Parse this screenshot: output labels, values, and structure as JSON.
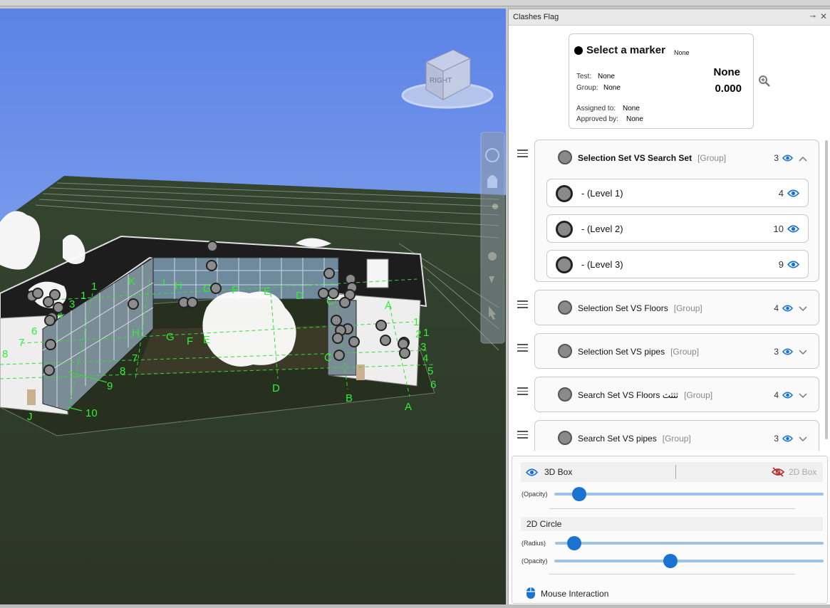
{
  "panel": {
    "title": "Clashes Flag",
    "pin_glyph": "⊸",
    "close_glyph": "✕"
  },
  "marker": {
    "title": "Select a marker",
    "title_value": "None",
    "test_label": "Test:",
    "test_value": "None",
    "group_label": "Group:",
    "group_value": "None",
    "assigned_label": "Assigned to:",
    "assigned_value": "None",
    "approved_label": "Approved by:",
    "approved_value": "None",
    "status": "None",
    "distance": "0.000",
    "zoom_icon": "magnifier-plus-icon"
  },
  "groups": [
    {
      "name": "Selection Set VS Search Set",
      "tag": "[Group]",
      "count": "3",
      "expanded": true,
      "children": [
        {
          "name": "- (Level 1)",
          "count": "4"
        },
        {
          "name": "- (Level 2)",
          "count": "10"
        },
        {
          "name": "- (Level 3)",
          "count": "9"
        }
      ]
    },
    {
      "name": "Selection Set VS Floors",
      "tag": "[Group]",
      "count": "4",
      "expanded": false
    },
    {
      "name": "Selection Set VS pipes",
      "tag": "[Group]",
      "count": "3",
      "expanded": false
    },
    {
      "name": "Search Set VS Floors ثثثث",
      "tag": "[Group]",
      "count": "4",
      "expanded": false
    },
    {
      "name": "Search Set VS pipes",
      "tag": "[Group]",
      "count": "3",
      "expanded": false
    }
  ],
  "settings": {
    "box3d_label": "3D Box",
    "box2d_label": "2D Box",
    "box_opacity_label": "(Opacity)",
    "box_opacity": 0.06,
    "circle_header": "2D Circle",
    "circle_radius_label": "(Radius)",
    "circle_radius": 0.04,
    "circle_opacity_label": "(Opacity)",
    "circle_opacity": 0.4,
    "mouse_label": "Mouse Interaction"
  },
  "viewcube": {
    "face_right": "RIGHT",
    "face_front": "BACK"
  },
  "scene_labels": {
    "numbers_left": [
      "1",
      "1",
      "3",
      "4",
      "6",
      "7",
      "8",
      "7",
      "8",
      "9",
      "10"
    ],
    "letters": [
      "K",
      "J",
      "H",
      "G",
      "F",
      "E",
      "D",
      "C",
      "B",
      "A",
      "I",
      "H",
      "G",
      "F",
      "E",
      "D",
      "C",
      "A"
    ],
    "numbers_right": [
      "1",
      "2",
      "1",
      "3",
      "4",
      "5",
      "6"
    ]
  },
  "colors": {
    "accent": "#1a73d1",
    "sky_top": "#5b82e6",
    "sky_bottom": "#9db8f2",
    "ground": "#2f3d2c",
    "grid": "#33dd33"
  }
}
